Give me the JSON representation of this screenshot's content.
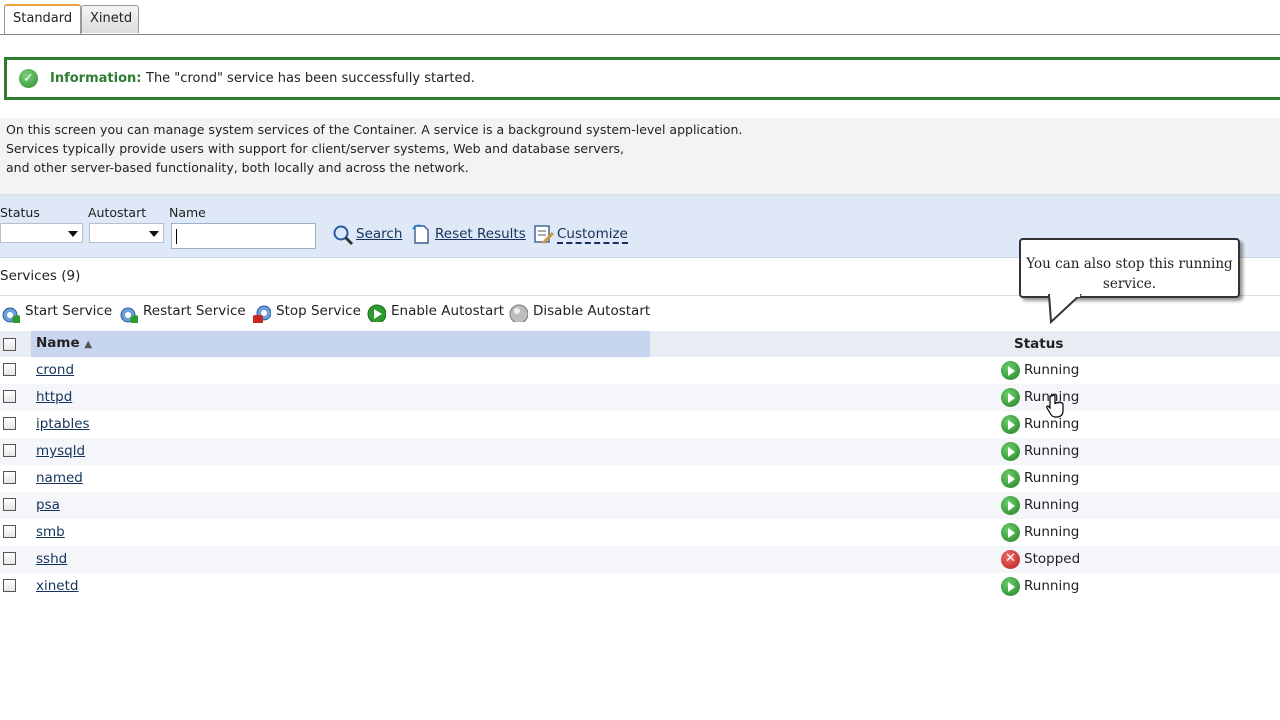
{
  "tabs": [
    {
      "label": "Standard",
      "active": true
    },
    {
      "label": "Xinetd",
      "active": false
    }
  ],
  "info": {
    "label": "Information:",
    "message": "The \"crond\" service has been successfully started."
  },
  "description": {
    "line1": "On this screen you can manage system services of the Container. A service is a background system-level application.",
    "line2": "Services typically provide users with support for client/server systems, Web and database servers,",
    "line3": "and other server-based functionality, both locally and across the network."
  },
  "filter": {
    "status_label": "Status",
    "autostart_label": "Autostart",
    "name_label": "Name",
    "name_value": "",
    "search": "Search",
    "reset": "Reset Results",
    "customize": "Customize"
  },
  "services_label": "Services (9)",
  "toolbar": {
    "start": "Start Service",
    "restart": "Restart Service",
    "stop": "Stop Service",
    "enable": "Enable Autostart",
    "disable": "Disable Autostart"
  },
  "table": {
    "col_name": "Name",
    "col_status": "Status",
    "rows": [
      {
        "name": "crond",
        "status": "Running"
      },
      {
        "name": "httpd",
        "status": "Running"
      },
      {
        "name": "iptables",
        "status": "Running"
      },
      {
        "name": "mysqld",
        "status": "Running"
      },
      {
        "name": "named",
        "status": "Running"
      },
      {
        "name": "psa",
        "status": "Running"
      },
      {
        "name": "smb",
        "status": "Running"
      },
      {
        "name": "sshd",
        "status": "Stopped"
      },
      {
        "name": "xinetd",
        "status": "Running"
      }
    ]
  },
  "callout": {
    "line1": "You can also stop this running",
    "line2": "service."
  },
  "colors": {
    "success": "#2e7d32",
    "filter_bg": "#dfe8f6",
    "link": "#16325c"
  }
}
